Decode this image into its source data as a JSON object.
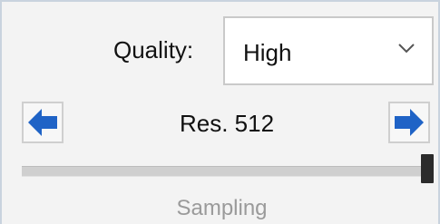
{
  "quality": {
    "label": "Quality:",
    "selected": "High"
  },
  "resolution": {
    "label": "Res. 512",
    "slider_level_fraction": 1.0
  },
  "group": {
    "title": "Sampling"
  },
  "colors": {
    "arrow_blue": "#1f63c6",
    "panel_bg": "#f3f3f3",
    "border": "#c9d3de",
    "group_title": "#9a9a9a"
  },
  "icons": {
    "left": "arrow-left-icon",
    "right": "arrow-right-icon",
    "dropdown": "chevron-down-icon"
  }
}
